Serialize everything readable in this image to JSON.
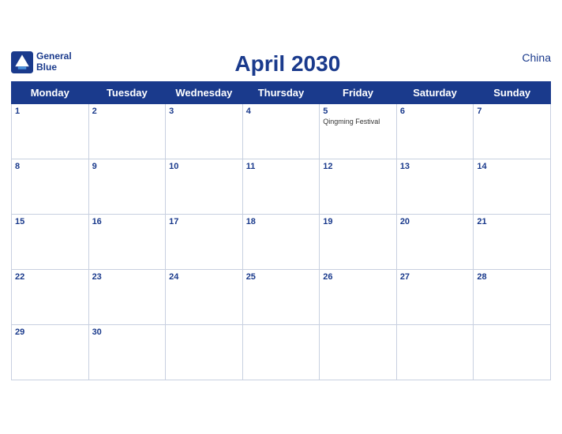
{
  "header": {
    "logo_line1": "General",
    "logo_line2": "Blue",
    "title": "April 2030",
    "region": "China"
  },
  "weekdays": [
    "Monday",
    "Tuesday",
    "Wednesday",
    "Thursday",
    "Friday",
    "Saturday",
    "Sunday"
  ],
  "weeks": [
    [
      {
        "day": "1",
        "event": ""
      },
      {
        "day": "2",
        "event": ""
      },
      {
        "day": "3",
        "event": ""
      },
      {
        "day": "4",
        "event": ""
      },
      {
        "day": "5",
        "event": "Qingming Festival"
      },
      {
        "day": "6",
        "event": ""
      },
      {
        "day": "7",
        "event": ""
      }
    ],
    [
      {
        "day": "8",
        "event": ""
      },
      {
        "day": "9",
        "event": ""
      },
      {
        "day": "10",
        "event": ""
      },
      {
        "day": "11",
        "event": ""
      },
      {
        "day": "12",
        "event": ""
      },
      {
        "day": "13",
        "event": ""
      },
      {
        "day": "14",
        "event": ""
      }
    ],
    [
      {
        "day": "15",
        "event": ""
      },
      {
        "day": "16",
        "event": ""
      },
      {
        "day": "17",
        "event": ""
      },
      {
        "day": "18",
        "event": ""
      },
      {
        "day": "19",
        "event": ""
      },
      {
        "day": "20",
        "event": ""
      },
      {
        "day": "21",
        "event": ""
      }
    ],
    [
      {
        "day": "22",
        "event": ""
      },
      {
        "day": "23",
        "event": ""
      },
      {
        "day": "24",
        "event": ""
      },
      {
        "day": "25",
        "event": ""
      },
      {
        "day": "26",
        "event": ""
      },
      {
        "day": "27",
        "event": ""
      },
      {
        "day": "28",
        "event": ""
      }
    ],
    [
      {
        "day": "29",
        "event": ""
      },
      {
        "day": "30",
        "event": ""
      },
      {
        "day": "",
        "event": ""
      },
      {
        "day": "",
        "event": ""
      },
      {
        "day": "",
        "event": ""
      },
      {
        "day": "",
        "event": ""
      },
      {
        "day": "",
        "event": ""
      }
    ]
  ]
}
